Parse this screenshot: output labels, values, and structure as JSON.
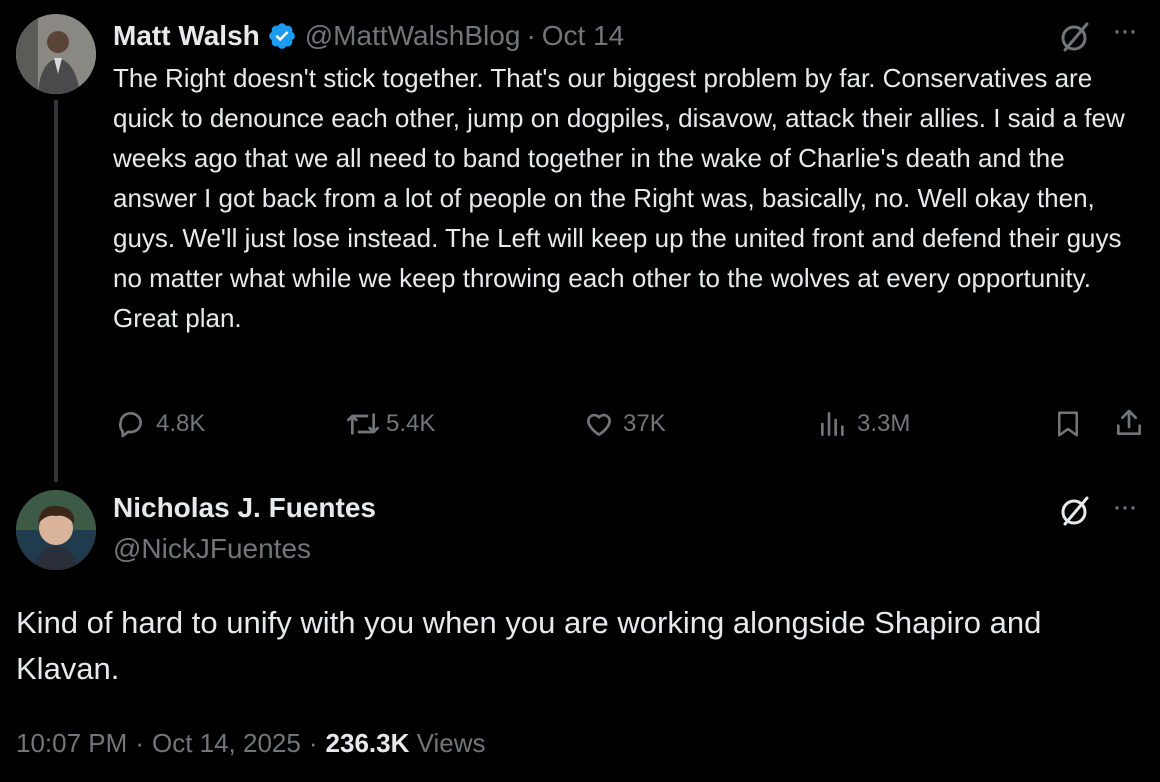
{
  "parent_tweet": {
    "author_name": "Matt Walsh",
    "handle": "@MattWalshBlog",
    "separator": "·",
    "date": "Oct 14",
    "text": "The Right doesn't stick together. That's our biggest problem by far. Conservatives are quick to denounce each other, jump on dogpiles, disavow, attack their allies. I said a few weeks ago that we all need to band together in the wake of Charlie's death and the answer I got back from a lot of people on the Right was, basically, no. Well okay then, guys. We'll just lose instead. The Left will keep up the united front and defend their guys no matter what while we keep throwing each other to the wolves at every opportunity. Great plan.",
    "actions": {
      "reply_count": "4.8K",
      "repost_count": "5.4K",
      "like_count": "37K",
      "views_count": "3.3M"
    },
    "icons": [
      "verified-badge-icon",
      "grok-icon",
      "more-icon",
      "reply-icon",
      "repost-icon",
      "like-icon",
      "views-icon",
      "bookmark-icon",
      "share-icon"
    ]
  },
  "main_tweet": {
    "author_name": "Nicholas J. Fuentes",
    "handle": "@NickJFuentes",
    "text": "Kind of hard to unify with you when you are working alongside Shapiro and Klavan.",
    "time": "10:07 PM",
    "separator1": "·",
    "date": "Oct 14, 2025",
    "separator2": "·",
    "views_count": "236.3K",
    "views_label": "Views"
  },
  "colors": {
    "background": "#000000",
    "text": "#e7e9ea",
    "muted": "#71767b",
    "verified_blue": "#1d9bf0",
    "thread_line": "#333639"
  }
}
